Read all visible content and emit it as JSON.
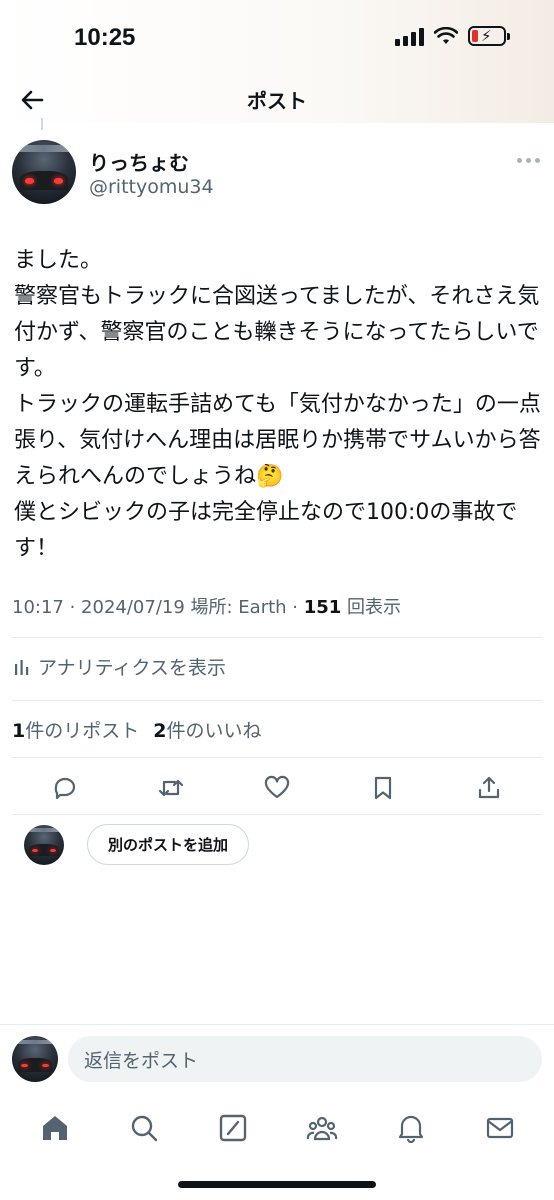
{
  "status_bar": {
    "time": "10:25"
  },
  "nav": {
    "title": "ポスト"
  },
  "author": {
    "display_name": "りっちょむ",
    "handle": "@rittyomu34"
  },
  "post": {
    "text": "ました。\n警察官もトラックに合図送ってましたが、それさえ気付かず、警察官のことも轢きそうになってたらしいです。\nトラックの運転手詰めても「気付かなかった」の一点張り、気付けへん理由は居眠りか携帯でサムいから答えられへんのでしょうね🤔\n僕とシビックの子は完全停止なので100:0の事故です！",
    "meta_prefix": "10:17 · 2024/07/19 場所: Earth · ",
    "view_count": "151",
    "view_label": " 回表示"
  },
  "analytics": {
    "label": "アナリティクスを表示"
  },
  "counts": {
    "reposts": "1",
    "reposts_label": "件のリポスト",
    "likes": "2",
    "likes_label": "件のいいね"
  },
  "add_post": {
    "label": "別のポストを追加"
  },
  "reply": {
    "placeholder": "返信をポスト"
  },
  "icons": [
    "back-arrow",
    "more",
    "analytics",
    "reply",
    "repost",
    "like",
    "bookmark",
    "share",
    "home",
    "search",
    "grok",
    "communities",
    "notifications",
    "messages"
  ]
}
